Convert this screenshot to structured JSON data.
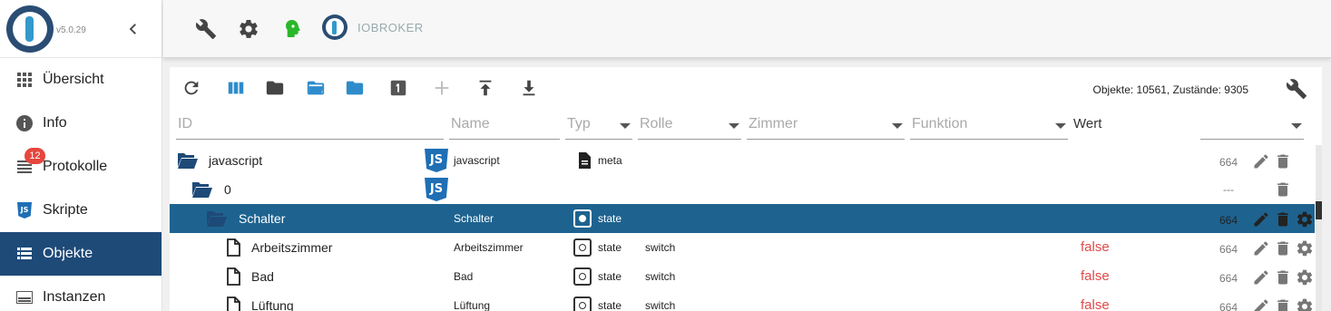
{
  "sidebar": {
    "version": "v5.0.29",
    "items": [
      {
        "label": "Übersicht",
        "icon": "grid-icon"
      },
      {
        "label": "Info",
        "icon": "info-icon"
      },
      {
        "label": "Protokolle",
        "icon": "list-icon",
        "badge": "12"
      },
      {
        "label": "Skripte",
        "icon": "js-icon"
      },
      {
        "label": "Objekte",
        "icon": "table-list-icon",
        "active": true
      },
      {
        "label": "Instanzen",
        "icon": "instances-icon"
      }
    ]
  },
  "topbar": {
    "title": "IOBROKER",
    "icons": [
      "wrench-icon",
      "gear-icon",
      "head-icon",
      "iobroker-logo"
    ]
  },
  "toolbar": {
    "counts": "Objekte: 10561, Zustände: 9305",
    "icons": [
      "refresh-icon",
      "columns-icon",
      "folder-icon",
      "folder-open-icon",
      "folder-blue-icon",
      "one-icon",
      "add-icon",
      "upload-icon",
      "download-icon",
      "wrench-icon"
    ]
  },
  "filters": {
    "id": "ID",
    "name": "Name",
    "typ": "Typ",
    "rolle": "Rolle",
    "zimmer": "Zimmer",
    "funktion": "Funktion",
    "wert": "Wert"
  },
  "rows": [
    {
      "id": "javascript",
      "name": "javascript",
      "type": "meta",
      "role": "",
      "value": "",
      "acl": "664"
    },
    {
      "id": "0",
      "name": "",
      "type": "",
      "role": "",
      "value": "",
      "acl": "---"
    },
    {
      "id": "Schalter",
      "name": "Schalter",
      "type": "state",
      "role": "",
      "value": "",
      "acl": "664"
    },
    {
      "id": "Arbeitszimmer",
      "name": "Arbeitszimmer",
      "type": "state",
      "role": "switch",
      "value": "false",
      "acl": "664"
    },
    {
      "id": "Bad",
      "name": "Bad",
      "type": "state",
      "role": "switch",
      "value": "false",
      "acl": "664"
    },
    {
      "id": "Lüftung",
      "name": "Lüftung",
      "type": "state",
      "role": "switch",
      "value": "false",
      "acl": "664"
    }
  ],
  "colors": {
    "brand": "#2b4d74",
    "active": "#1e4a78",
    "selected_row": "#1e6390",
    "accent": "#3399cc",
    "false": "#e04a4a",
    "badge": "#e5463d"
  }
}
